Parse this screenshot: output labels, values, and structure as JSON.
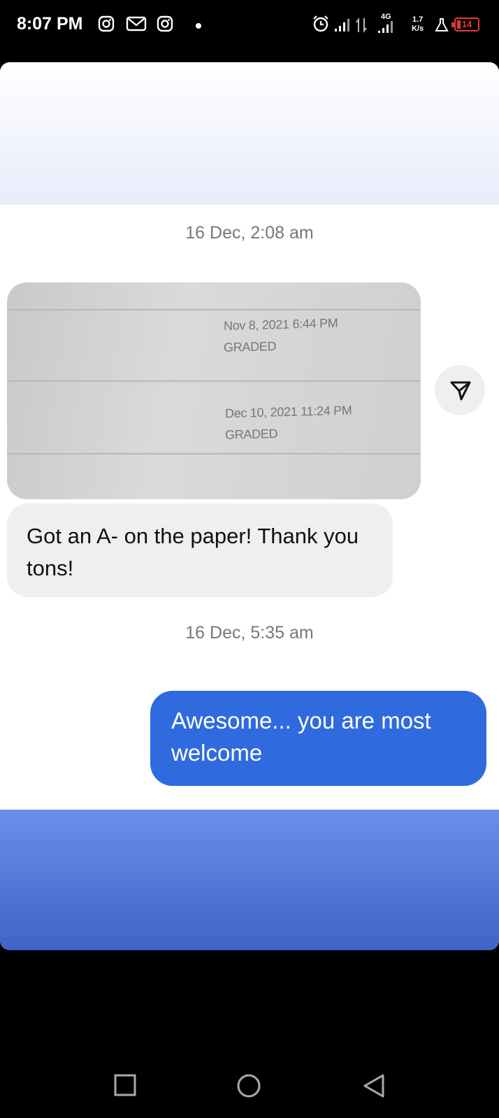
{
  "status_bar": {
    "time": "8:07 PM",
    "network_type": "4G",
    "speed_value": "1.7",
    "speed_unit": "K/s",
    "battery": "14",
    "battery_color": "#e53935",
    "icons": [
      "instagram-icon",
      "gmail-icon",
      "instagram-icon",
      "notification-dot-icon",
      "alarm-icon",
      "signal-icon",
      "data-transfer-icon",
      "signal-icon",
      "lab-icon",
      "battery-icon"
    ]
  },
  "conversation": {
    "timestamp_1": "16 Dec, 2:08 am",
    "photo": {
      "row_1_date": "Nov 8, 2021 6:44 PM",
      "row_1_status": "GRADED",
      "row_2_date": "Dec 10, 2021 11:24 PM",
      "row_2_status": "GRADED"
    },
    "received_message": "Got an A- on the paper! Thank you tons!",
    "timestamp_2": "16 Dec, 5:35 am",
    "sent_message": "Awesome... you are most welcome",
    "sent_bubble_color": "#2f6bdf",
    "received_bubble_color": "#efefef"
  },
  "nav_bar": {
    "buttons": [
      "recents-square-icon",
      "home-circle-icon",
      "back-triangle-icon"
    ]
  }
}
